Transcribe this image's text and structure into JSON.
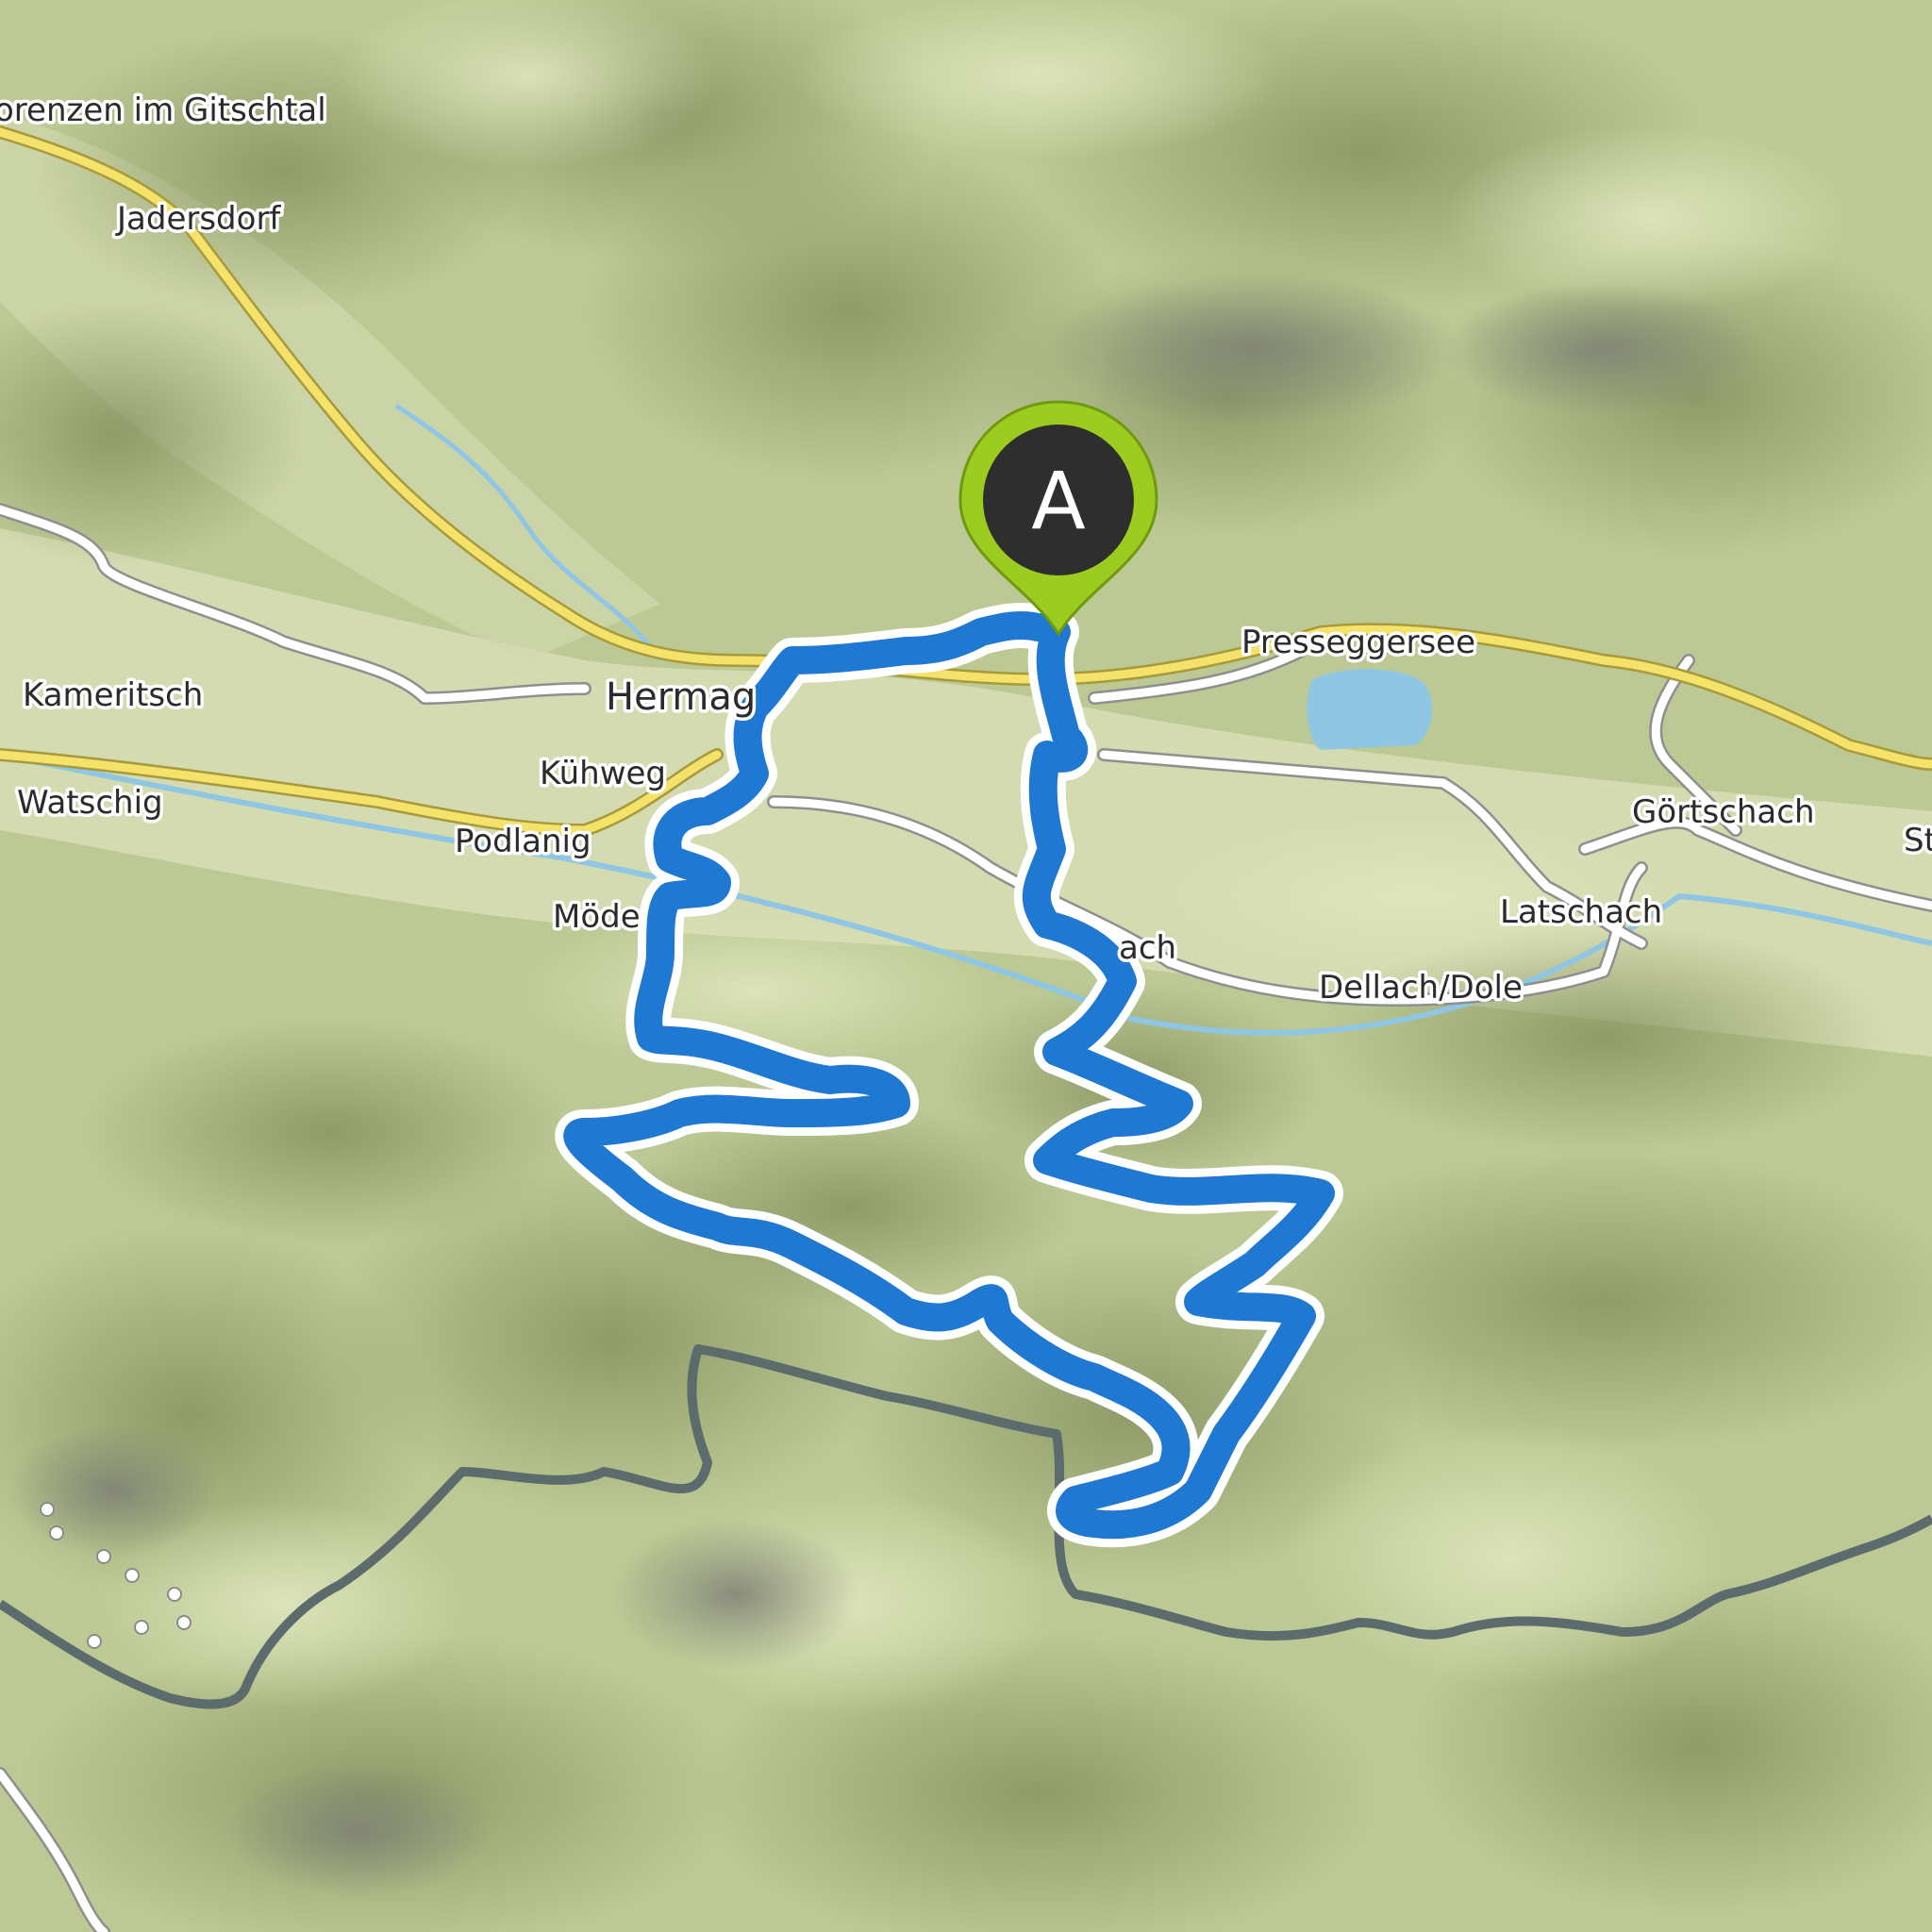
{
  "map": {
    "colors": {
      "terrain_base": "#bcc994",
      "terrain_light": "#cdd8a8",
      "valley": "#d9dfb8",
      "shadow": "#8e9a68",
      "rock": "#8a8d80",
      "lake": "#8fc6e3",
      "river": "#8fc6e3",
      "main_road": "#f4e26a",
      "road_casing": "#a79a3c",
      "minor_road": "#ffffff",
      "border": "#5c6b6b",
      "route": "#1f78d1",
      "route_casing": "#ffffff",
      "marker_fill": "#2e2e2e",
      "marker_ring": "#9ccc1f"
    },
    "place_labels": [
      {
        "key": "st_lorenzen",
        "text": "orenzen im Gitschtal"
      },
      {
        "key": "jadersdorf",
        "text": "Jadersdorf"
      },
      {
        "key": "kameritsch",
        "text": "Kameritsch"
      },
      {
        "key": "hermagor",
        "text": "Hermag"
      },
      {
        "key": "kuehweg",
        "text": "Kühweg"
      },
      {
        "key": "watschig",
        "text": "Watschig"
      },
      {
        "key": "podlanig",
        "text": "Podlanig"
      },
      {
        "key": "moede",
        "text": "Möde"
      },
      {
        "key": "presseggersee",
        "text": "Presseggersee"
      },
      {
        "key": "goertschach",
        "text": "Görtschach"
      },
      {
        "key": "latschach",
        "text": "Latschach"
      },
      {
        "key": "dellach",
        "text": "Dellach/Dole"
      },
      {
        "key": "nach",
        "text": "ach"
      },
      {
        "key": "st_edge",
        "text": "St"
      }
    ],
    "start_marker": {
      "letter": "A",
      "icon": "map-pin-icon"
    }
  }
}
